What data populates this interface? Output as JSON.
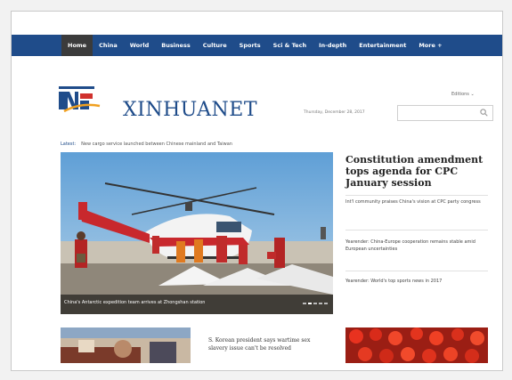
{
  "nav": {
    "items": [
      {
        "label": "Home",
        "active": true
      },
      {
        "label": "China",
        "active": false
      },
      {
        "label": "World",
        "active": false
      },
      {
        "label": "Business",
        "active": false
      },
      {
        "label": "Culture",
        "active": false
      },
      {
        "label": "Sports",
        "active": false
      },
      {
        "label": "Sci & Tech",
        "active": false
      },
      {
        "label": "In-depth",
        "active": false
      },
      {
        "label": "Entertainment",
        "active": false
      },
      {
        "label": "More +",
        "active": false
      }
    ]
  },
  "header": {
    "site_name": "XINHUANET",
    "editions_label": "Editions ⌄",
    "date": "Thursday, December 28, 2017",
    "search_placeholder": ""
  },
  "latest": {
    "label": "Latest:",
    "text": "New cargo service launched between Chinese mainland and Taiwan"
  },
  "hero": {
    "caption": "China's Antarctic expedition team arrives at Zhongshan station"
  },
  "top_story": {
    "headline": "Constitution amendment tops agenda for CPC January session",
    "links": [
      "Int'l community praises China's vision at CPC party congress",
      "Yearender: China-Europe cooperation remains stable amid European uncertainties",
      "Yearender: World's top sports news in 2017"
    ]
  },
  "bottom": {
    "story_text": "S. Korean president says wartime sex slavery issue can't be resolved"
  },
  "colors": {
    "brand_blue": "#1f4c8a",
    "nav_active": "#3b3b3b"
  }
}
